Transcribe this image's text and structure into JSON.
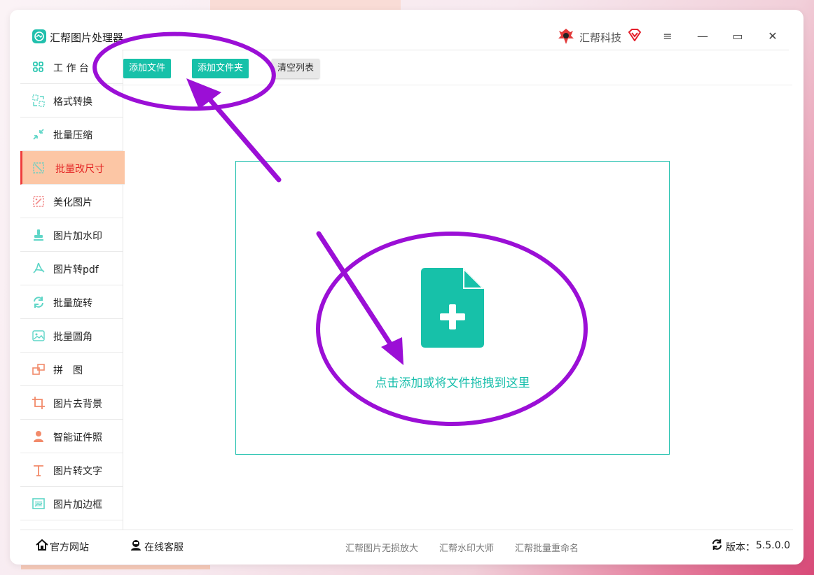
{
  "app": {
    "title": "汇帮图片处理器",
    "brand": "汇帮科技"
  },
  "window_controls": {
    "menu": "≡",
    "minimize": "—",
    "maximize": "▭",
    "close": "✕"
  },
  "sidebar": {
    "items": [
      {
        "label": "工 作 台",
        "icon": "grid-icon",
        "active": false
      },
      {
        "label": "格式转换",
        "icon": "convert-icon",
        "active": false
      },
      {
        "label": "批量压缩",
        "icon": "compress-icon",
        "active": false
      },
      {
        "label": "批量改尺寸",
        "icon": "resize-icon",
        "active": true
      },
      {
        "label": "美化图片",
        "icon": "beautify-icon",
        "active": false
      },
      {
        "label": "图片加水印",
        "icon": "watermark-icon",
        "active": false
      },
      {
        "label": "图片转pdf",
        "icon": "pdf-icon",
        "active": false
      },
      {
        "label": "批量旋转",
        "icon": "rotate-icon",
        "active": false
      },
      {
        "label": "批量圆角",
        "icon": "rounded-corner-icon",
        "active": false
      },
      {
        "label": "拼　图",
        "icon": "puzzle-icon",
        "active": false
      },
      {
        "label": "图片去背景",
        "icon": "crop-icon",
        "active": false
      },
      {
        "label": "智能证件照",
        "icon": "person-icon",
        "active": false
      },
      {
        "label": "图片转文字",
        "icon": "text-icon",
        "active": false
      },
      {
        "label": "图片加边框",
        "icon": "frame-icon",
        "active": false
      }
    ]
  },
  "toolbar": {
    "add_file": "添加文件",
    "add_folder": "添加文件夹",
    "clear_list": "清空列表"
  },
  "dropzone": {
    "hint": "点击添加或将文件拖拽到这里"
  },
  "footer": {
    "website": "官方网站",
    "support": "在线客服",
    "links": [
      "汇帮图片无损放大",
      "汇帮水印大师",
      "汇帮批量重命名"
    ],
    "version_label": "版本：",
    "version": "5.5.0.0"
  },
  "colors": {
    "accent": "#17c1a9",
    "active_bg": "#fcc6a5",
    "active_text": "#e42424",
    "annotation": "#9b0fd6"
  }
}
